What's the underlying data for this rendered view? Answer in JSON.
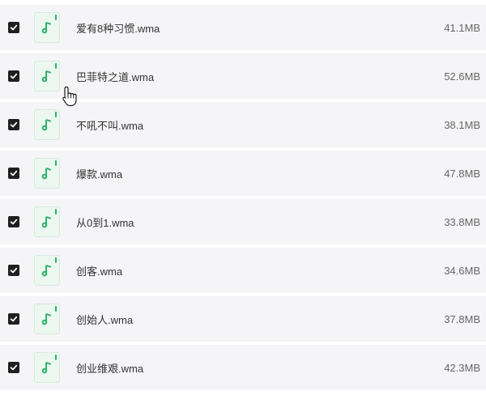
{
  "colors": {
    "row_background": "#f5f5f7",
    "checkbox": "#1f1f1f",
    "icon_accent": "#2db36b",
    "icon_background": "#ecf7f0",
    "name_text": "#333333",
    "size_text": "#666666"
  },
  "icons": {
    "checkbox": "checkmark-icon",
    "file": "music-note-icon",
    "cursor": "hand-pointer-icon"
  },
  "files": [
    {
      "name": "爱有8种习惯.wma",
      "size": "41.1MB",
      "checked": true
    },
    {
      "name": "巴菲特之道.wma",
      "size": "52.6MB",
      "checked": true
    },
    {
      "name": "不吼不叫.wma",
      "size": "38.1MB",
      "checked": true
    },
    {
      "name": "爆款.wma",
      "size": "47.8MB",
      "checked": true
    },
    {
      "name": "从0到1.wma",
      "size": "33.8MB",
      "checked": true
    },
    {
      "name": "创客.wma",
      "size": "34.6MB",
      "checked": true
    },
    {
      "name": "创始人.wma",
      "size": "37.8MB",
      "checked": true
    },
    {
      "name": "创业维艰.wma",
      "size": "42.3MB",
      "checked": true
    }
  ]
}
